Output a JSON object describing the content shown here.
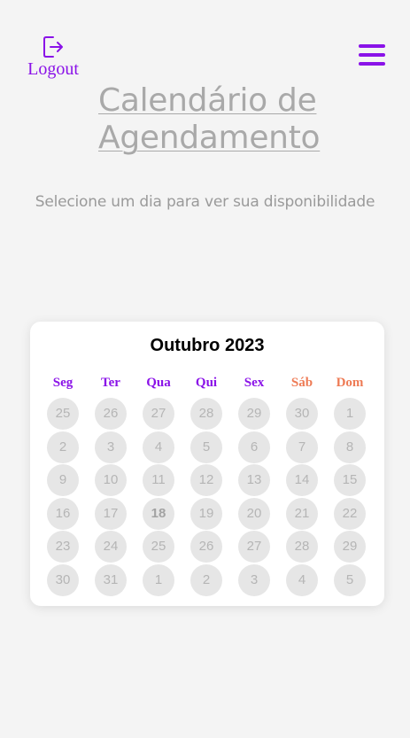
{
  "header": {
    "logout_label": "Logout",
    "logout_icon": "logout-icon",
    "menu_icon": "hamburger-menu-icon",
    "accent_color": "#8a12e8"
  },
  "page": {
    "title_line1": "Calendário de",
    "title_line2": "Agendamento",
    "subtitle": "Selecione um dia para ver sua disponibilidade"
  },
  "calendar": {
    "month_label": "Outubro 2023",
    "weekdays": [
      "Seg",
      "Ter",
      "Qua",
      "Qui",
      "Sex",
      "Sáb",
      "Dom"
    ],
    "weekend_color": "#ee7b55",
    "highlighted_day": "18",
    "weeks": [
      [
        "25",
        "26",
        "27",
        "28",
        "29",
        "30",
        "1"
      ],
      [
        "2",
        "3",
        "4",
        "5",
        "6",
        "7",
        "8"
      ],
      [
        "9",
        "10",
        "11",
        "12",
        "13",
        "14",
        "15"
      ],
      [
        "16",
        "17",
        "18",
        "19",
        "20",
        "21",
        "22"
      ],
      [
        "23",
        "24",
        "25",
        "26",
        "27",
        "28",
        "29"
      ],
      [
        "30",
        "31",
        "1",
        "2",
        "3",
        "4",
        "5"
      ]
    ]
  }
}
